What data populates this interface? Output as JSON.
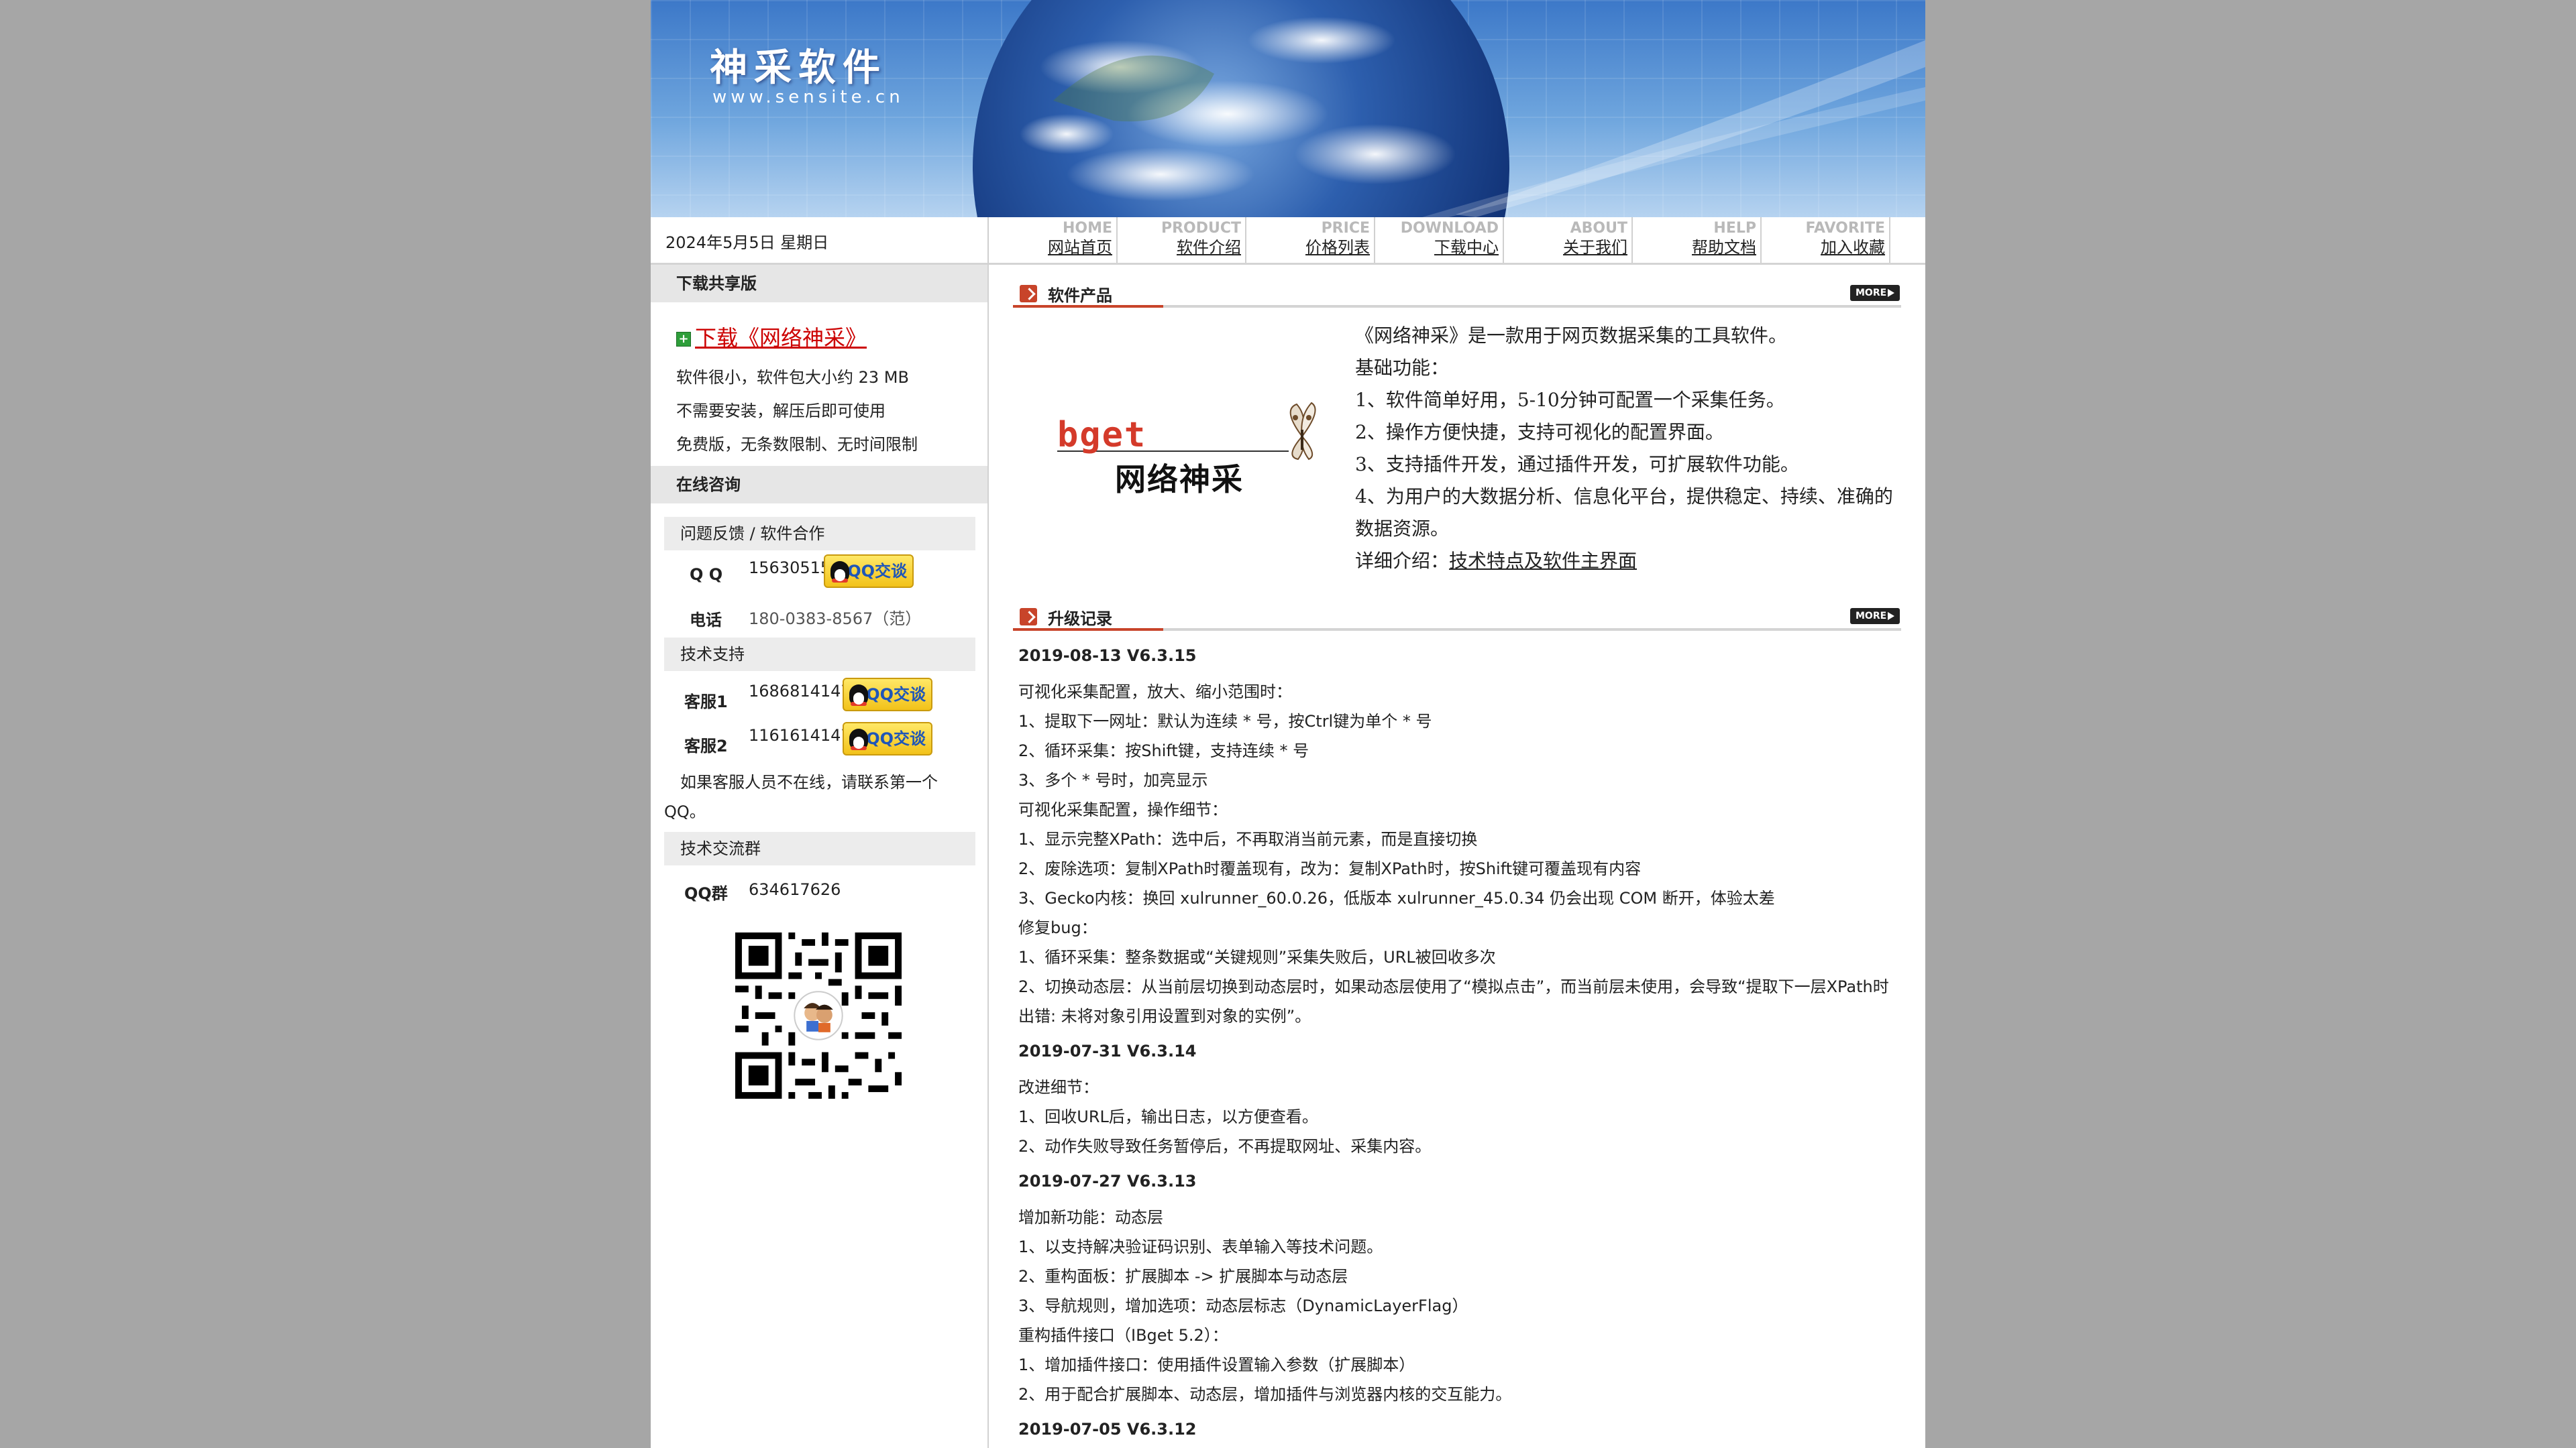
{
  "header": {
    "logo_text": "神采软件",
    "logo_url": "www.sensite.cn"
  },
  "nav": {
    "date": "2024年5月5日 星期日",
    "items": [
      {
        "en": "HOME",
        "cn": "网站首页"
      },
      {
        "en": "PRODUCT",
        "cn": "软件介绍"
      },
      {
        "en": "PRICE",
        "cn": "价格列表"
      },
      {
        "en": "DOWNLOAD",
        "cn": "下载中心"
      },
      {
        "en": "ABOUT",
        "cn": "关于我们"
      },
      {
        "en": "HELP",
        "cn": "帮助文档"
      },
      {
        "en": "FAVORITE",
        "cn": "加入收藏"
      }
    ]
  },
  "sidebar": {
    "download_head": "下载共享版",
    "download_link": "下载《网络神采》",
    "download_notes": [
      "软件很小，软件包大小约 23 MB",
      "不需要安装，解压后即可使用",
      "免费版，无条数限制、无时间限制"
    ],
    "consult_head": "在线咨询",
    "feedback_head": "问题反馈 / 软件合作",
    "qq_label": "Q Q",
    "qq_value": "15630515",
    "phone_label": "电话",
    "phone_value": "180-0383-8567（范）",
    "support_head": "技术支持",
    "cs1_label": "客服1",
    "cs1_value": "1686814147",
    "cs2_label": "客服2",
    "cs2_value": "1161614147",
    "offline_note": "如果客服人员不在线，请联系第一个QQ。",
    "group_head": "技术交流群",
    "group_label": "QQ群",
    "group_value": "634617626",
    "qq_button_text": "QQ交谈"
  },
  "main": {
    "more_label": "MORE",
    "product": {
      "title": "软件产品",
      "logo_brand": "bget",
      "logo_name": "网络神采",
      "lines": [
        "《网络神采》是一款用于网页数据采集的工具软件。",
        "基础功能：",
        "1、软件简单好用，5-10分钟可配置一个采集任务。",
        "2、操作方便快捷，支持可视化的配置界面。",
        "3、支持插件开发，通过插件开发，可扩展软件功能。",
        "4、为用户的大数据分析、信息化平台，提供稳定、持续、准确的",
        "数据资源。"
      ],
      "detail_prefix": "详细介绍：",
      "detail_link": "技术特点及软件主界面"
    },
    "changelog": {
      "title": "升级记录",
      "entries": [
        {
          "version": "2019-08-13 V6.3.15",
          "lines": [
            "可视化采集配置，放大、缩小范围时：",
            "1、提取下一网址：默认为连续 * 号，按Ctrl键为单个 * 号",
            "2、循环采集：按Shift键，支持连续 * 号",
            "3、多个 * 号时，加亮显示",
            "可视化采集配置，操作细节：",
            "1、显示完整XPath：选中后，不再取消当前元素，而是直接切换",
            "2、废除选项：复制XPath时覆盖现有，改为：复制XPath时，按Shift键可覆盖现有内容",
            "3、Gecko内核：换回 xulrunner_60.0.26，低版本 xulrunner_45.0.34 仍会出现 COM 断开，体验太差",
            "修复bug：",
            "1、循环采集：整条数据或“关键规则”采集失败后，URL被回收多次",
            "2、切换动态层：从当前层切换到动态层时，如果动态层使用了“模拟点击”，而当前层未使用，会导致“提取下一层XPath时出错: 未将对象引用设置到对象的实例”。"
          ]
        },
        {
          "version": "2019-07-31 V6.3.14",
          "lines": [
            "改进细节：",
            "1、回收URL后，输出日志，以方便查看。",
            "2、动作失败导致任务暂停后，不再提取网址、采集内容。"
          ]
        },
        {
          "version": "2019-07-27 V6.3.13",
          "lines": [
            "增加新功能：动态层",
            "1、以支持解决验证码识别、表单输入等技术问题。",
            "2、重构面板：扩展脚本 -> 扩展脚本与动态层",
            "3、导航规则，增加选项：动态层标志（DynamicLayerFlag）",
            "重构插件接口（IBget 5.2）：",
            "1、增加插件接口：使用插件设置输入参数（扩展脚本）",
            "2、用于配合扩展脚本、动态层，增加插件与浏览器内核的交互能力。"
          ]
        },
        {
          "version": "2019-07-05 V6.3.12",
          "lines": []
        }
      ]
    }
  }
}
